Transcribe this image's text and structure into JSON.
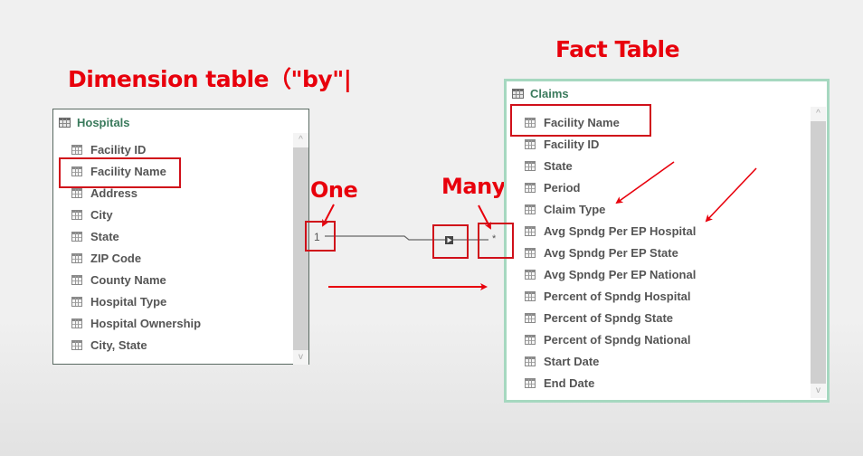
{
  "annotations": {
    "dimension_title": "Dimension table（\"by\"|",
    "fact_title": "Fact Table",
    "one_label": "One",
    "many_label": "Many"
  },
  "dimension_table": {
    "name": "Hospitals",
    "fields": [
      {
        "label": "Facility ID"
      },
      {
        "label": "Facility Name",
        "highlighted": true
      },
      {
        "label": "Address"
      },
      {
        "label": "City"
      },
      {
        "label": "State"
      },
      {
        "label": "ZIP Code"
      },
      {
        "label": "County Name"
      },
      {
        "label": "Hospital Type"
      },
      {
        "label": "Hospital Ownership"
      },
      {
        "label": "City, State"
      }
    ]
  },
  "fact_table": {
    "name": "Claims",
    "fields": [
      {
        "label": "Facility Name",
        "highlighted": true
      },
      {
        "label": "Facility ID"
      },
      {
        "label": "State"
      },
      {
        "label": "Period"
      },
      {
        "label": "Claim Type"
      },
      {
        "label": "Avg Spndg Per EP Hospital"
      },
      {
        "label": "Avg Spndg Per EP State"
      },
      {
        "label": "Avg Spndg Per EP National"
      },
      {
        "label": "Percent of Spndg Hospital"
      },
      {
        "label": "Percent of Spndg State"
      },
      {
        "label": "Percent of Spndg National"
      },
      {
        "label": "Start Date"
      },
      {
        "label": "End Date"
      }
    ]
  },
  "relationship": {
    "from_table": "Hospitals",
    "to_table": "Claims",
    "from_cardinality": "1",
    "to_cardinality": "*",
    "filter_direction_icon": "play-arrow-icon"
  },
  "scrollbar": {
    "up_glyph": "^",
    "down_glyph": "v"
  },
  "colors": {
    "annotation_red": "#e8000c",
    "table_title_green": "#3a7a5c",
    "selected_table_border": "#a6d8c0",
    "field_text": "#555555"
  }
}
